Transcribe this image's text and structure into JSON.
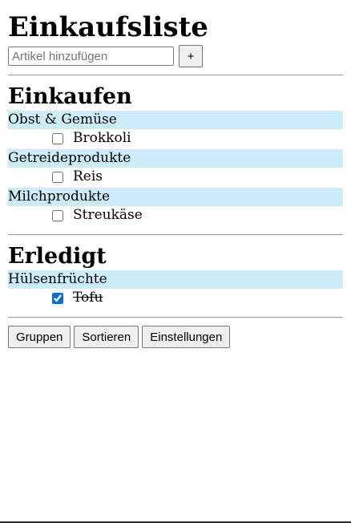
{
  "app": {
    "title": "Einkaufsliste"
  },
  "add": {
    "placeholder": "Artikel hinzufügen",
    "button_label": "+"
  },
  "shopping": {
    "heading": "Einkaufen",
    "groups": [
      {
        "label": "Obst & Gemüse",
        "items": [
          {
            "label": "Brokkoli",
            "checked": false
          }
        ]
      },
      {
        "label": "Getreideprodukte",
        "items": [
          {
            "label": "Reis",
            "checked": false
          }
        ]
      },
      {
        "label": "Milchprodukte",
        "items": [
          {
            "label": "Streukäse",
            "checked": false
          }
        ]
      }
    ]
  },
  "done": {
    "heading": "Erledigt",
    "groups": [
      {
        "label": "Hülsenfrüchte",
        "items": [
          {
            "label": "Tofu",
            "checked": true
          }
        ]
      }
    ]
  },
  "footer": {
    "groups_label": "Gruppen",
    "sort_label": "Sortieren",
    "settings_label": "Einstellungen"
  },
  "colors": {
    "group_bg": "#cdecf9",
    "checkbox_accent": "#0a6ed1"
  }
}
